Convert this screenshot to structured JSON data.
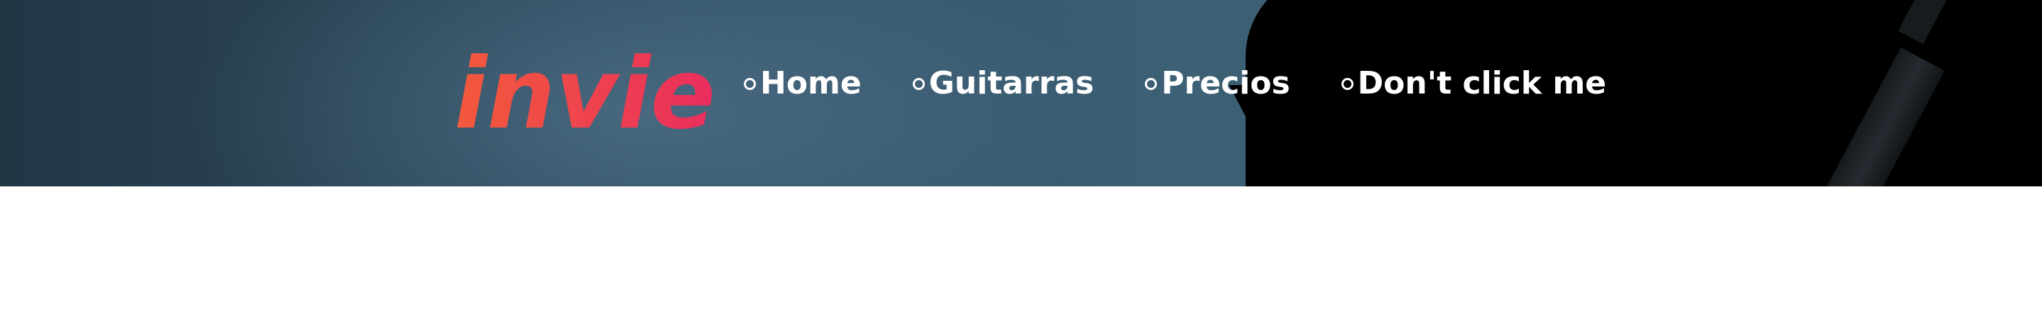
{
  "brand": {
    "logo_text": "invie",
    "gradient_start": "#f35a3c",
    "gradient_end": "#ea2d5e"
  },
  "nav": {
    "items": [
      {
        "label": "Home"
      },
      {
        "label": "Guitarras"
      },
      {
        "label": "Precios"
      },
      {
        "label": "Don't click me"
      }
    ]
  },
  "colors": {
    "nav_text": "#ffffff",
    "hero_bg": "#3a5c70",
    "page_bg": "#ffffff"
  }
}
